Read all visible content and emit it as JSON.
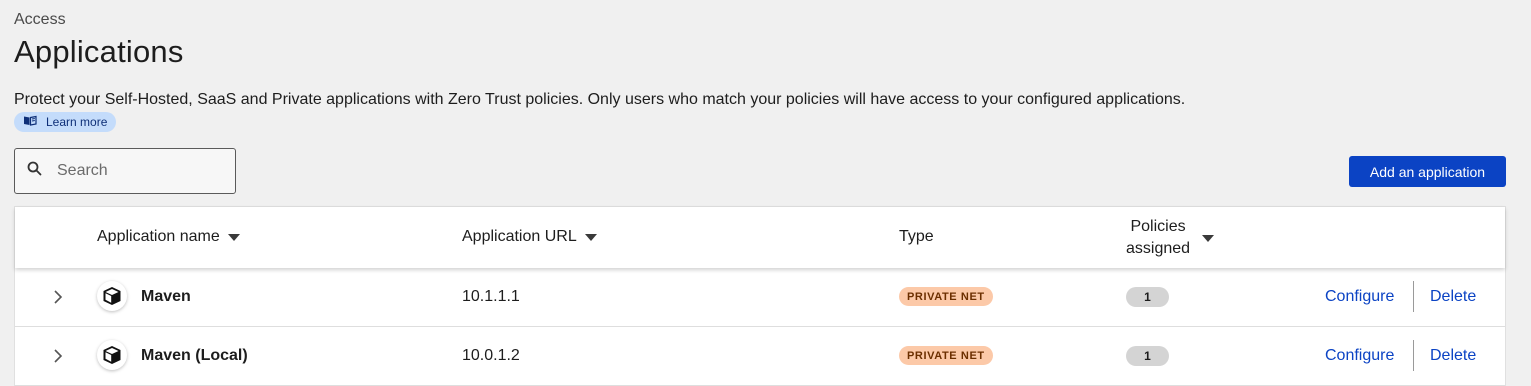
{
  "breadcrumb": "Access",
  "page_title": "Applications",
  "description": "Protect your Self-Hosted, SaaS and Private applications with Zero Trust policies. Only users who match your policies will have access to your configured applications.",
  "learn_more": "Learn more",
  "search": {
    "placeholder": "Search",
    "value": ""
  },
  "add_button": "Add an application",
  "table": {
    "columns": {
      "name": "Application name",
      "url": "Application URL",
      "type": "Type",
      "policies_line1": "Policies",
      "policies_line2": "assigned"
    },
    "rows": [
      {
        "name": "Maven",
        "url": "10.1.1.1",
        "type": "PRIVATE NET",
        "policies": "1",
        "configure": "Configure",
        "delete": "Delete"
      },
      {
        "name": "Maven (Local)",
        "url": "10.0.1.2",
        "type": "PRIVATE NET",
        "policies": "1",
        "configure": "Configure",
        "delete": "Delete"
      }
    ]
  },
  "colors": {
    "accent": "#0b43c4",
    "badge_bg": "#fcc9a8",
    "learn_bg": "#c4dcfb"
  },
  "icons": {
    "learn": "book-icon",
    "search": "search-icon",
    "expand": "chevron-right-icon",
    "app": "cube-icon",
    "sort": "caret-down-icon"
  }
}
